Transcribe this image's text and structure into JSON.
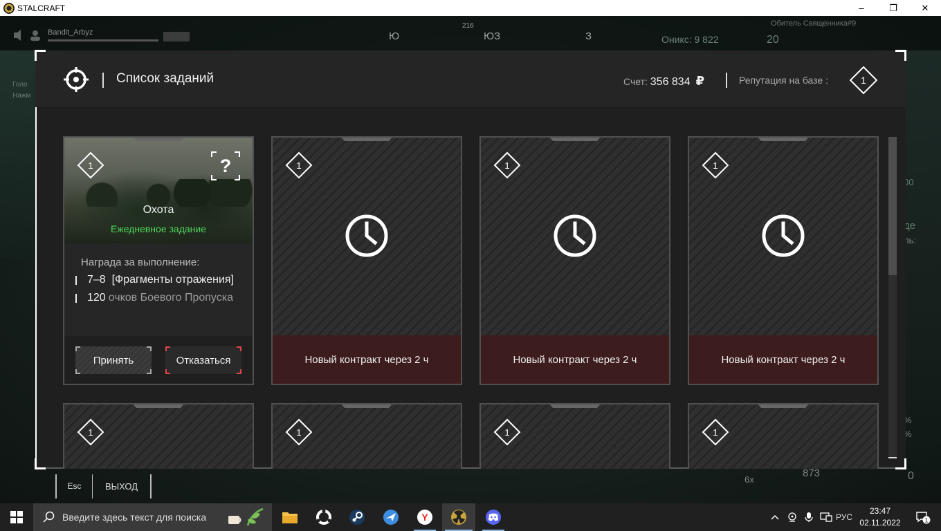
{
  "window": {
    "app_name": "STALCRAFT",
    "minimize": "–",
    "restore": "❐",
    "close": "✕"
  },
  "hud": {
    "player_name": "Bandit_Arbyz",
    "compass_degree": "216",
    "compass_marks": [
      "Ю",
      "ЮЗ",
      "З"
    ],
    "rank": "Обитель Священника#9",
    "onyx": "Оникс: 9 822",
    "onyx_count": "20",
    "ammo": "873",
    "zoom": "6x",
    "slot": "",
    "left_side": [
      "Голо",
      "Нажм"
    ],
    "right_side": [
      "00",
      "де",
      "ль:",
      "%",
      "%",
      "0"
    ]
  },
  "modal": {
    "title": "Список заданий",
    "balance_label": "Счет:",
    "balance_value": "356 834",
    "currency": "₽",
    "reputation_label": "Репутация на базе :",
    "reputation_level": "1"
  },
  "active_task": {
    "level": "1",
    "help": "?",
    "name": "Охота",
    "type": "Ежедневное задание",
    "reward_title": "Награда за выполнение:",
    "rewards": [
      {
        "amount": "7–8",
        "text": "[Фрагменты отражения]",
        "dim": ""
      },
      {
        "amount": "120",
        "text": "",
        "dim": "очков Боевого Пропуска"
      }
    ],
    "accept_label": "Принять",
    "decline_label": "Отказаться"
  },
  "pending_cards": [
    {
      "level": "1",
      "footer": "Новый контракт через 2 ч"
    },
    {
      "level": "1",
      "footer": "Новый контракт через 2 ч"
    },
    {
      "level": "1",
      "footer": "Новый контракт через 2 ч"
    }
  ],
  "second_row_cards": [
    {
      "level": "1"
    },
    {
      "level": "1"
    },
    {
      "level": "1"
    },
    {
      "level": "1"
    }
  ],
  "bottom_bar": {
    "esc_key": "Esc",
    "exit_label": "ВЫХОД"
  },
  "taskbar": {
    "search_placeholder": "Введите здесь текст для поиска",
    "language": "РУС",
    "time": "23:47",
    "date": "02.11.2022",
    "notifications": "1"
  },
  "colors": {
    "daily_green": "#4ed45a",
    "contract_red": "#3c1c1c",
    "decline_accent": "#e0444b"
  }
}
